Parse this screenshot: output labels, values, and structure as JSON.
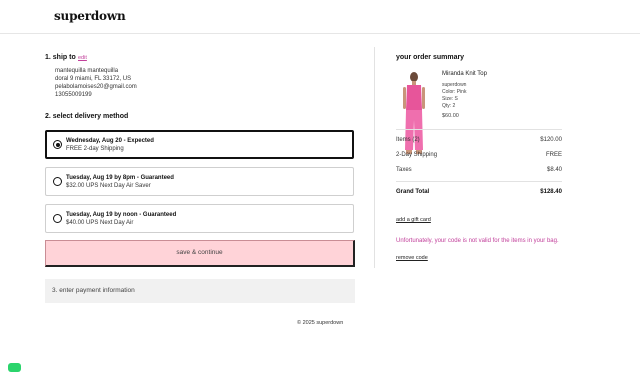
{
  "brand": {
    "logo": "superdown"
  },
  "shipping": {
    "title": "1. ship to",
    "edit_label": "edit",
    "address_lines": [
      "mantequilla mantequilla",
      "doral 9 miami, FL 33172, US",
      "pelabolamoises20@gmail.com",
      "13055009199"
    ]
  },
  "delivery": {
    "title": "2. select delivery method",
    "options": [
      {
        "title": "Wednesday, Aug 20 - Expected",
        "subtitle": "FREE 2-day Shipping",
        "selected": true
      },
      {
        "title": "Tuesday, Aug 19 by 8pm - Guaranteed",
        "subtitle": "$32.00 UPS Next Day Air Saver",
        "selected": false
      },
      {
        "title": "Tuesday, Aug 19 by noon - Guaranteed",
        "subtitle": "$40.00 UPS Next Day Air",
        "selected": false
      }
    ]
  },
  "save_button": "save & continue",
  "payment": {
    "title": "3. enter payment information"
  },
  "footer": {
    "copyright": "© 2025 superdown"
  },
  "summary": {
    "title": "your order summary",
    "product": {
      "name": "Miranda Knit Top",
      "brand": "superdown",
      "color": "Color: Pink",
      "size": "Size: S",
      "qty": "Qty: 2",
      "price": "$60.00"
    },
    "rows": {
      "items_label": "Items (2)",
      "items_value": "$120.00",
      "shipping_label": "2-Day Shipping",
      "shipping_value": "FREE",
      "taxes_label": "Taxes",
      "taxes_value": "$8.40",
      "total_label": "Grand Total",
      "total_value": "$128.40"
    },
    "gift_card_link": "add a gift card",
    "error_message": "Unfortunately, your code is not valid for the items in your bag.",
    "remove_code_link": "remove code"
  },
  "colors": {
    "accent_pink": "#c2409b",
    "button_bg": "#ffd3d8",
    "chat_badge": "#2bd46c"
  }
}
